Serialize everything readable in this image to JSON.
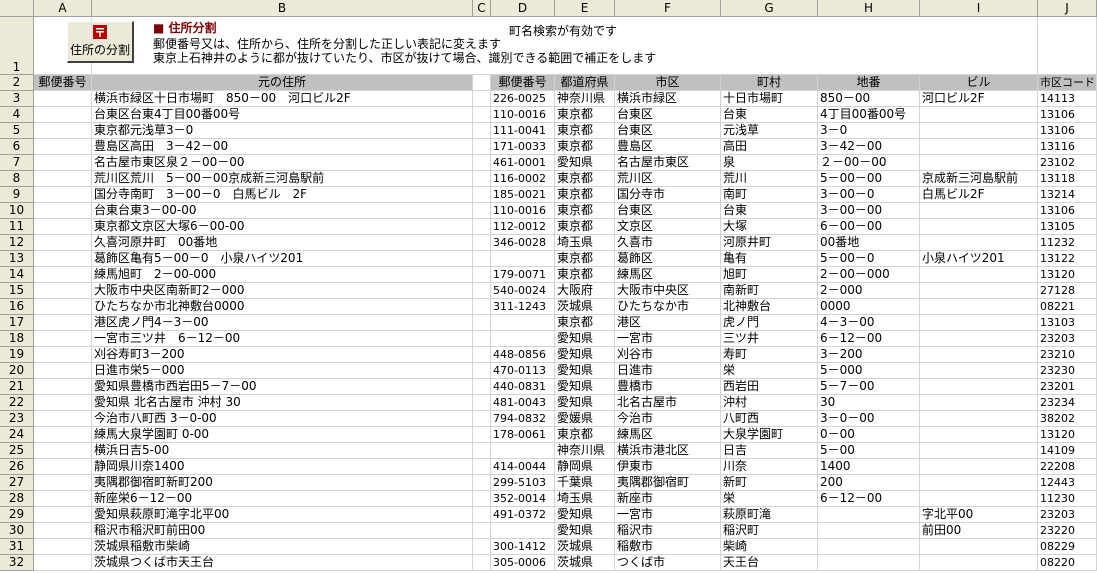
{
  "columns": [
    "A",
    "B",
    "C",
    "D",
    "E",
    "F",
    "G",
    "H",
    "I",
    "J"
  ],
  "toolbar": {
    "button_label": "住所の分割",
    "title": "■ 住所分割",
    "status": "町名検索が有効です",
    "desc1": "郵便番号又は、住所から、住所を分割した正しい表記に変えます",
    "desc2": "東京上石神井のように都が抜けていたり、市区が抜けて場合、識別できる範囲で補正をします"
  },
  "headers": {
    "A": "郵便番号",
    "B": "元の住所",
    "C": "",
    "D": "郵便番号",
    "E": "都道府県",
    "F": "市区",
    "G": "町村",
    "H": "地番",
    "I": "ビル",
    "J": "市区コード"
  },
  "rows": [
    {
      "r": "3",
      "A": "",
      "B": "横浜市緑区十日市場町　850－00　河口ビル2F",
      "D": "226-0025",
      "E": "神奈川県",
      "F": "横浜市緑区",
      "G": "十日市場町",
      "H": "850－00",
      "I": "河口ビル2F",
      "J": "14113"
    },
    {
      "r": "4",
      "A": "",
      "B": "台東区台東4丁目00番00号",
      "D": "110-0016",
      "E": "東京都",
      "F": "台東区",
      "G": "台東",
      "H": "4丁目00番00号",
      "I": "",
      "J": "13106"
    },
    {
      "r": "5",
      "A": "",
      "B": "東京都元浅草3－0",
      "D": "111-0041",
      "E": "東京都",
      "F": "台東区",
      "G": "元浅草",
      "H": "3－0",
      "I": "",
      "J": "13106"
    },
    {
      "r": "6",
      "A": "",
      "B": "豊島区高田　3－42－00",
      "D": "171-0033",
      "E": "東京都",
      "F": "豊島区",
      "G": "高田",
      "H": "3－42－00",
      "I": "",
      "J": "13116"
    },
    {
      "r": "7",
      "A": "",
      "B": "名古屋市東区泉２－00－00",
      "D": "461-0001",
      "E": "愛知県",
      "F": "名古屋市東区",
      "G": "泉",
      "H": "２－00－00",
      "I": "",
      "J": "23102"
    },
    {
      "r": "8",
      "A": "",
      "B": "荒川区荒川　5－00－00京成新三河島駅前",
      "D": "116-0002",
      "E": "東京都",
      "F": "荒川区",
      "G": "荒川",
      "H": "5－00－00",
      "I": "京成新三河島駅前",
      "J": "13118"
    },
    {
      "r": "9",
      "A": "",
      "B": "国分寺南町　3－00－0　白馬ビル　2F",
      "D": "185-0021",
      "E": "東京都",
      "F": "国分寺市",
      "G": "南町",
      "H": "3－00－0",
      "I": "白馬ビル2F",
      "J": "13214"
    },
    {
      "r": "10",
      "A": "",
      "B": "台東台東3－00-00",
      "D": "110-0016",
      "E": "東京都",
      "F": "台東区",
      "G": "台東",
      "H": "3－00－00",
      "I": "",
      "J": "13106"
    },
    {
      "r": "11",
      "A": "",
      "B": "東京都文京区大塚6－00-00",
      "D": "112-0012",
      "E": "東京都",
      "F": "文京区",
      "G": "大塚",
      "H": "6－00－00",
      "I": "",
      "J": "13105"
    },
    {
      "r": "12",
      "A": "",
      "B": "久喜河原井町　00番地",
      "D": "346-0028",
      "E": "埼玉県",
      "F": "久喜市",
      "G": "河原井町",
      "H": "00番地",
      "I": "",
      "J": "11232"
    },
    {
      "r": "13",
      "A": "",
      "B": "葛飾区亀有5－00－0　小泉ハイツ201",
      "D": "",
      "E": "東京都",
      "F": "葛飾区",
      "G": "亀有",
      "H": "5－00－0",
      "I": "小泉ハイツ201",
      "J": "13122"
    },
    {
      "r": "14",
      "A": "",
      "B": "練馬旭町　2－00-000",
      "D": "179-0071",
      "E": "東京都",
      "F": "練馬区",
      "G": "旭町",
      "H": "2－00－000",
      "I": "",
      "J": "13120"
    },
    {
      "r": "15",
      "A": "",
      "B": "大阪市中央区南新町2－000",
      "D": "540-0024",
      "E": "大阪府",
      "F": "大阪市中央区",
      "G": "南新町",
      "H": "2－000",
      "I": "",
      "J": "27128"
    },
    {
      "r": "16",
      "A": "",
      "B": "ひたちなか市北神敷台0000",
      "D": "311-1243",
      "E": "茨城県",
      "F": "ひたちなか市",
      "G": "北神敷台",
      "H": "0000",
      "I": "",
      "J": "08221"
    },
    {
      "r": "17",
      "A": "",
      "B": "港区虎ノ門4－3－00",
      "D": "",
      "E": "東京都",
      "F": "港区",
      "G": "虎ノ門",
      "H": "4－3－00",
      "I": "",
      "J": "13103"
    },
    {
      "r": "18",
      "A": "",
      "B": "一宮市三ツ井　6－12－00",
      "D": "",
      "E": "愛知県",
      "F": "一宮市",
      "G": "三ツ井",
      "H": "6－12－00",
      "I": "",
      "J": "23203"
    },
    {
      "r": "19",
      "A": "",
      "B": "刈谷寿町3－200",
      "D": "448-0856",
      "E": "愛知県",
      "F": "刈谷市",
      "G": "寿町",
      "H": "3－200",
      "I": "",
      "J": "23210"
    },
    {
      "r": "20",
      "A": "",
      "B": "日進市栄5－000",
      "D": "470-0113",
      "E": "愛知県",
      "F": "日進市",
      "G": "栄",
      "H": "5－000",
      "I": "",
      "J": "23230"
    },
    {
      "r": "21",
      "A": "",
      "B": "愛知県豊橋市西岩田5－7－00",
      "D": "440-0831",
      "E": "愛知県",
      "F": "豊橋市",
      "G": "西岩田",
      "H": "5－7－00",
      "I": "",
      "J": "23201"
    },
    {
      "r": "22",
      "A": "",
      "B": "愛知県 北名古屋市 沖村 30",
      "D": "481-0043",
      "E": "愛知県",
      "F": "北名古屋市",
      "G": "沖村",
      "H": "30",
      "I": "",
      "J": "23234"
    },
    {
      "r": "23",
      "A": "",
      "B": "今治市八町西 3－0-00",
      "D": "794-0832",
      "E": "愛媛県",
      "F": "今治市",
      "G": "八町西",
      "H": "3－0－00",
      "I": "",
      "J": "38202"
    },
    {
      "r": "24",
      "A": "",
      "B": "練馬大泉学園町 0-00",
      "D": "178-0061",
      "E": "東京都",
      "F": "練馬区",
      "G": "大泉学園町",
      "H": "0－00",
      "I": "",
      "J": "13120"
    },
    {
      "r": "25",
      "A": "",
      "B": "横浜日吉5-00",
      "D": "",
      "E": "神奈川県",
      "F": "横浜市港北区",
      "G": "日吉",
      "H": "5－00",
      "I": "",
      "J": "14109"
    },
    {
      "r": "26",
      "A": "",
      "B": "静岡県川奈1400",
      "D": "414-0044",
      "E": "静岡県",
      "F": "伊東市",
      "G": "川奈",
      "H": "1400",
      "I": "",
      "J": "22208"
    },
    {
      "r": "27",
      "A": "",
      "B": "夷隅郡御宿町新町200",
      "D": "299-5103",
      "E": "千葉県",
      "F": "夷隅郡御宿町",
      "G": "新町",
      "H": "200",
      "I": "",
      "J": "12443"
    },
    {
      "r": "28",
      "A": "",
      "B": "新座栄6－12－00",
      "D": "352-0014",
      "E": "埼玉県",
      "F": "新座市",
      "G": "栄",
      "H": "6－12－00",
      "I": "",
      "J": "11230"
    },
    {
      "r": "29",
      "A": "",
      "B": "愛知県萩原町滝字北平00",
      "D": "491-0372",
      "E": "愛知県",
      "F": "一宮市",
      "G": "萩原町滝",
      "H": "",
      "I": "字北平00",
      "J": "23203"
    },
    {
      "r": "30",
      "A": "",
      "B": "稲沢市稲沢町前田00",
      "D": "",
      "E": "愛知県",
      "F": "稲沢市",
      "G": "稲沢町",
      "H": "",
      "I": "前田00",
      "J": "23220"
    },
    {
      "r": "31",
      "A": "",
      "B": "茨城県稲敷市柴崎",
      "D": "300-1412",
      "E": "茨城県",
      "F": "稲敷市",
      "G": "柴崎",
      "H": "",
      "I": "",
      "J": "08229"
    },
    {
      "r": "32",
      "A": "",
      "B": "茨城県つくば市天王台",
      "D": "305-0006",
      "E": "茨城県",
      "F": "つくば市",
      "G": "天王台",
      "H": "",
      "I": "",
      "J": "08220"
    }
  ]
}
